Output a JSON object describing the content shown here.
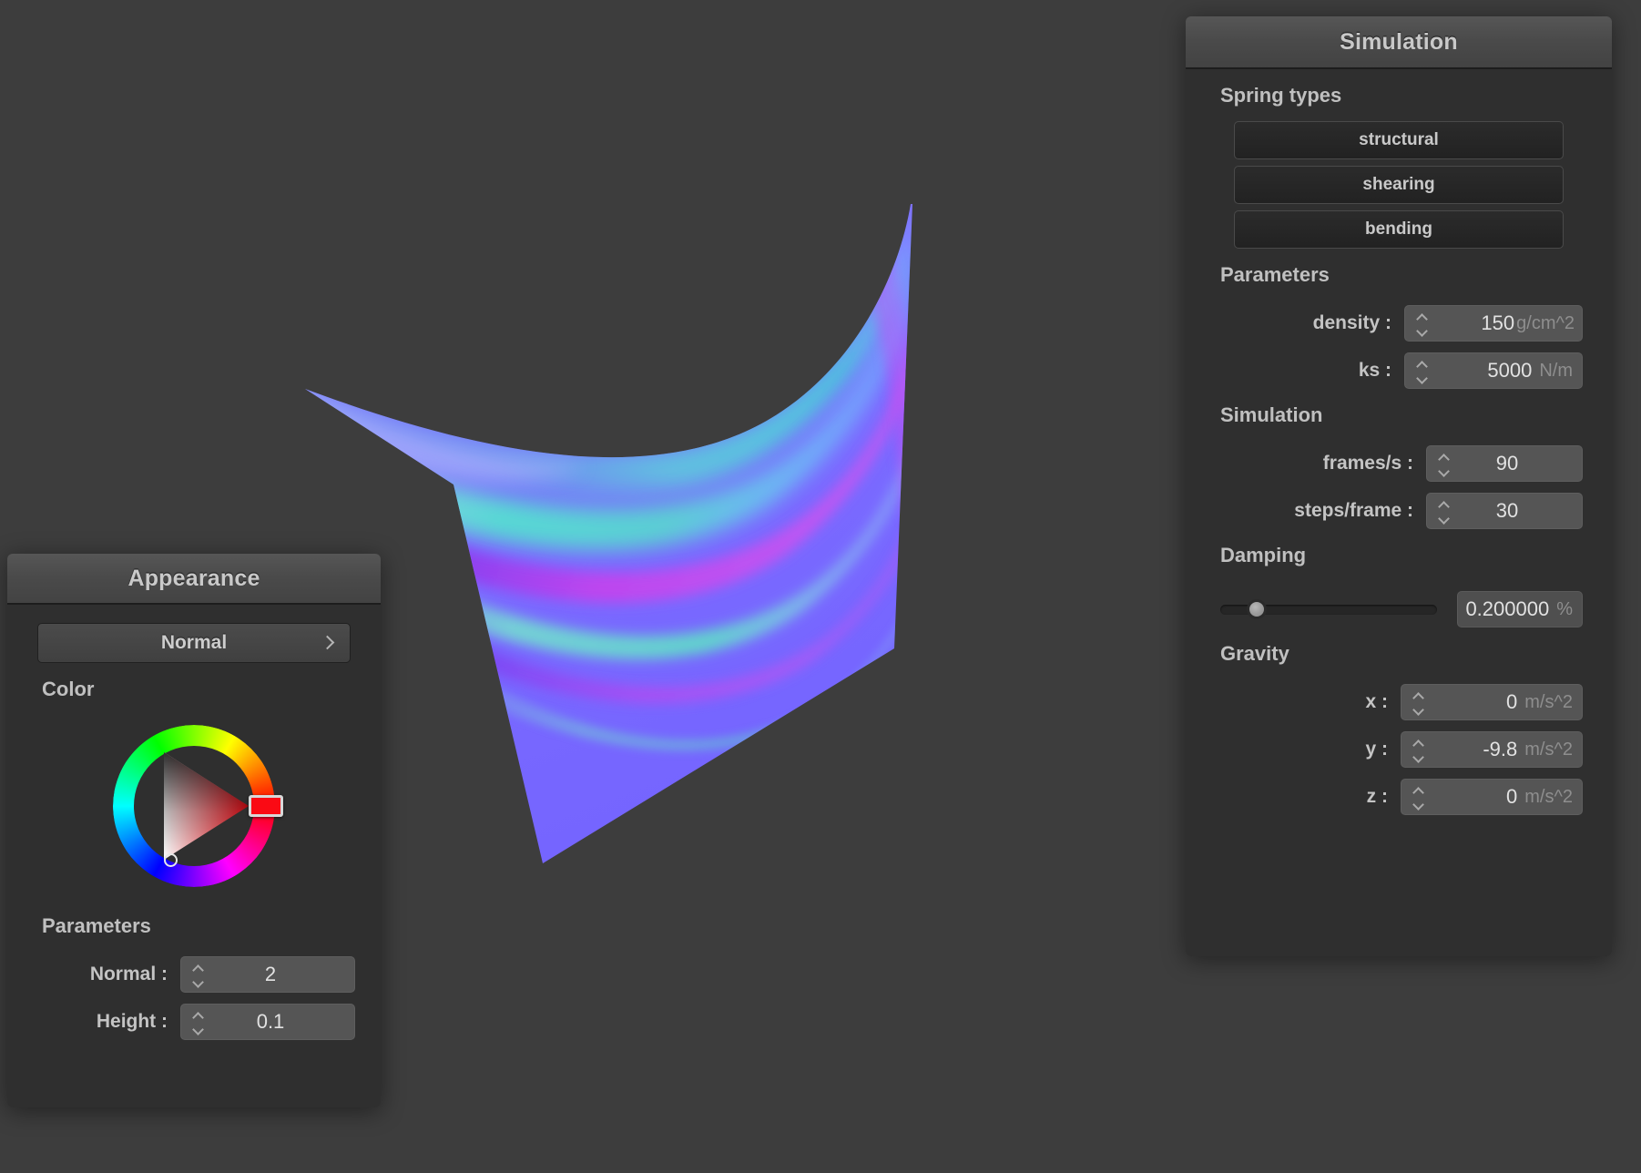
{
  "app": {
    "background_color": "#3d3d3d",
    "panel_color": "#2f2f2f"
  },
  "viewport": {
    "name": "cloth-simulation-viewport",
    "mesh_color": "#7a6bff",
    "highlight_colors": [
      "#5ee0d0",
      "#c04ae8",
      "#8a5cff"
    ]
  },
  "simulation_panel": {
    "title": "Simulation",
    "spring_types": {
      "label": "Spring types",
      "buttons": [
        {
          "label": "structural"
        },
        {
          "label": "shearing"
        },
        {
          "label": "bending"
        }
      ]
    },
    "parameters": {
      "label": "Parameters",
      "fields": [
        {
          "label": "density :",
          "value": "150",
          "unit": "g/cm^2"
        },
        {
          "label": "ks :",
          "value": "5000",
          "unit": "N/m"
        }
      ]
    },
    "simulation": {
      "label": "Simulation",
      "fields": [
        {
          "label": "frames/s :",
          "value": "90",
          "unit": ""
        },
        {
          "label": "steps/frame :",
          "value": "30",
          "unit": ""
        }
      ]
    },
    "damping": {
      "label": "Damping",
      "slider_percent": 17,
      "value": "0.200000",
      "unit": "%"
    },
    "gravity": {
      "label": "Gravity",
      "fields": [
        {
          "label": "x :",
          "value": "0",
          "unit": "m/s^2"
        },
        {
          "label": "y :",
          "value": "-9.8",
          "unit": "m/s^2"
        },
        {
          "label": "z :",
          "value": "0",
          "unit": "m/s^2"
        }
      ]
    }
  },
  "appearance_panel": {
    "title": "Appearance",
    "shading_mode": "Normal",
    "chevron_icon": "chevron-right-icon",
    "color": {
      "label": "Color",
      "selected_hex": "#fa0a14"
    },
    "parameters": {
      "label": "Parameters",
      "fields": [
        {
          "label": "Normal :",
          "value": "2"
        },
        {
          "label": "Height :",
          "value": "0.1"
        }
      ]
    }
  }
}
